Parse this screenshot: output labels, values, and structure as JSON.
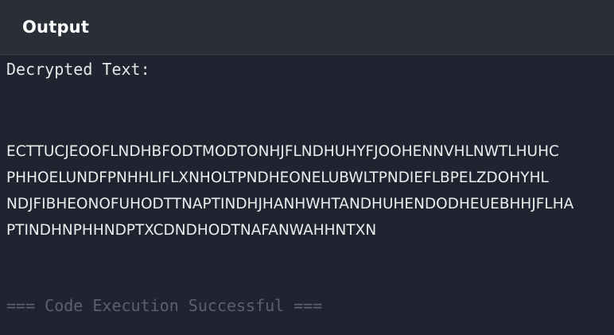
{
  "header": {
    "title": "Output"
  },
  "output": {
    "label": "Decrypted Text:",
    "lines": [
      "ECTTUCJEOOFLNDHBFODTMODTONHJFLNDHUHYFJOOHENNVHLNWTLHUHC",
      "PHHOELUNDFPNHHLIFLXNHOLTPNDHEONELUBWLTPNDIEFLBPELZDOHYHL",
      "NDJFIBHEONOFUHODTTNAPTINDHJHANHWHTANDHUHENDODHEUEBHHJFLHA",
      "PTINDHNPHHNDPTXCDNDHODTNAFANWAHHNTXN"
    ],
    "status": "=== Code Execution Successful ==="
  },
  "colors": {
    "background": "#1f2430",
    "header_background": "#2a2e37",
    "text": "#e6e6e6",
    "status_text": "#5b606b"
  }
}
